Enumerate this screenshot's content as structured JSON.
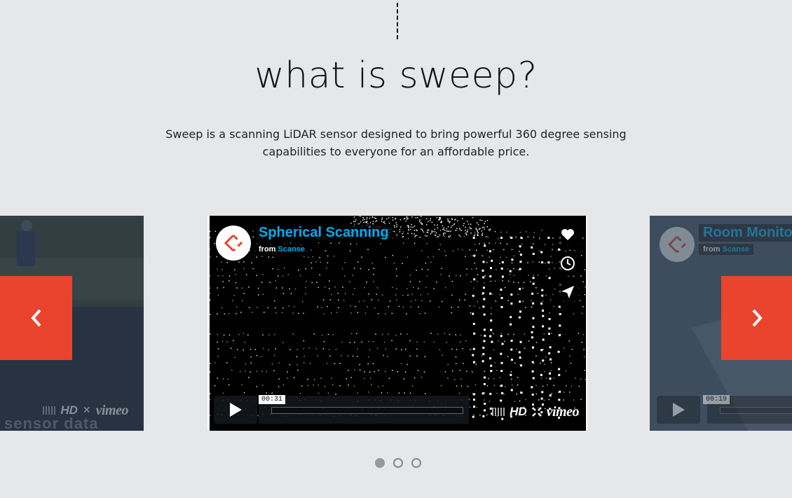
{
  "header": {
    "title": "what is sweep?",
    "description": "Sweep is a scanning LiDAR sensor designed to bring powerful 360 degree sensing capabilities to everyone for an affordable price."
  },
  "carousel": {
    "prev_icon": "chevron-left-icon",
    "next_icon": "chevron-right-icon",
    "accent_color": "#e9442e",
    "dots": [
      {
        "active": true
      },
      {
        "active": false
      },
      {
        "active": false
      }
    ],
    "slides": {
      "left": {
        "caption_fragment": "sensor data",
        "hd_label": "HD",
        "vimeo_label": "vimeo"
      },
      "center": {
        "video_title": "Spherical Scanning",
        "from_label": "from",
        "author": "Scanse",
        "time_tooltip": "00:31",
        "hd_label": "HD",
        "vimeo_label": "vimeo",
        "side_buttons": [
          "heart-icon",
          "clock-icon",
          "send-icon"
        ]
      },
      "right": {
        "video_title": "Room Monito",
        "from_label": "from",
        "author": "Scanse",
        "time_tooltip": "00:19"
      }
    }
  }
}
